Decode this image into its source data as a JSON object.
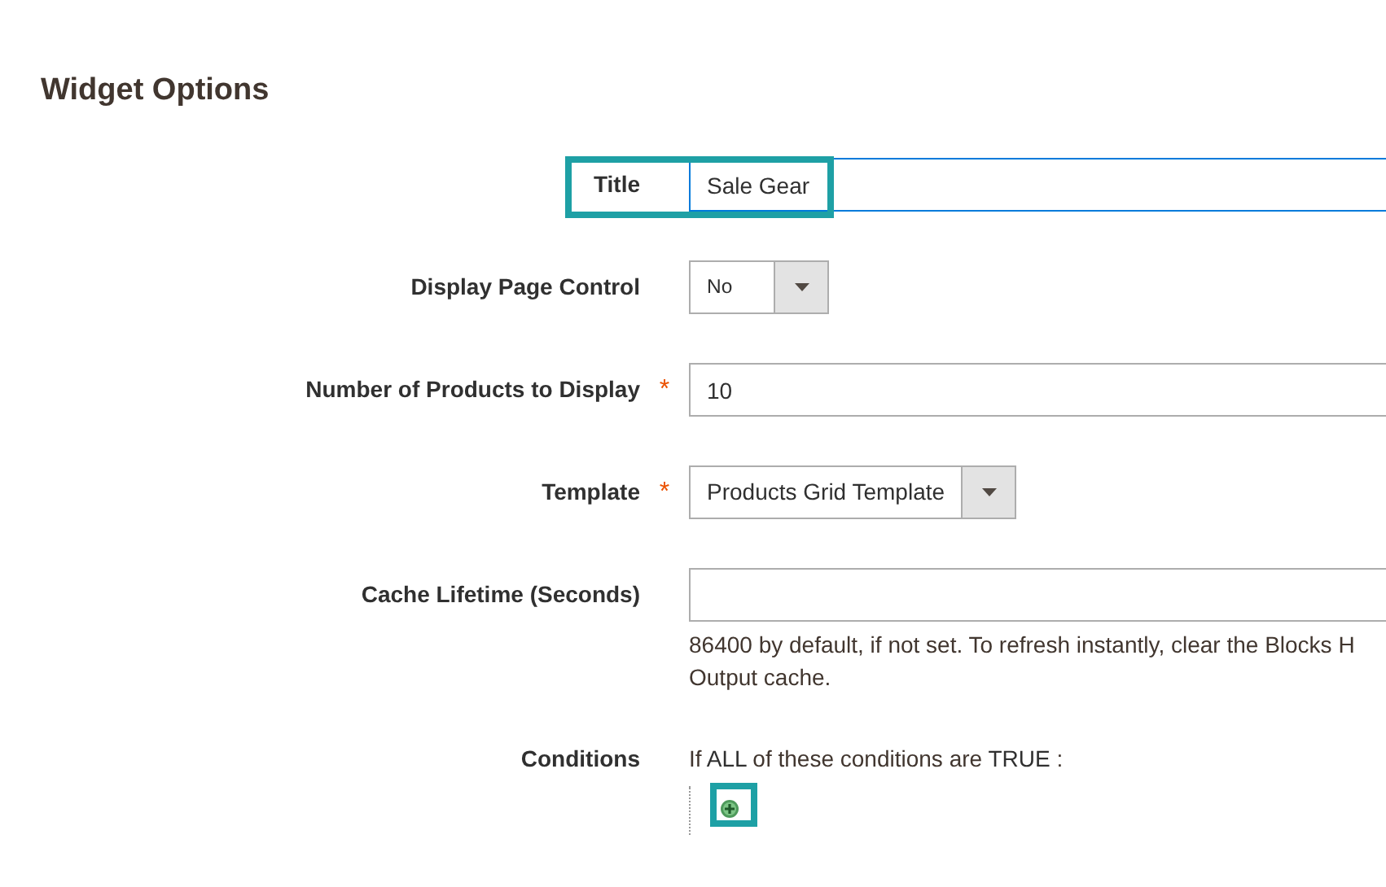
{
  "section_title": "Widget Options",
  "fields": [
    {
      "kind": "text",
      "label": "Title",
      "value": "Sale Gear",
      "focused": true,
      "highlighted": true
    },
    {
      "kind": "select",
      "label": "Display Page Control",
      "value": "No",
      "highlighted": false
    },
    {
      "kind": "text",
      "label": "Number of Products to Display",
      "required_mark": "*",
      "value": "10",
      "focused": false,
      "highlighted": false
    },
    {
      "kind": "select",
      "label": "Template",
      "required_mark": "*",
      "value": "Products Grid Template",
      "highlighted": false
    },
    {
      "kind": "text",
      "label": "Cache Lifetime (Seconds)",
      "focused": false,
      "highlighted": false,
      "note_lines": [
        "86400 by default, if not set. To refresh instantly, clear the Blocks H",
        "Output cache."
      ]
    }
  ],
  "conditions": {
    "label": "Conditions",
    "prefix": "If",
    "aggregator": "ALL",
    "middle": "of these conditions are",
    "value": "TRUE",
    "suffix": ":",
    "add_highlighted": true
  }
}
